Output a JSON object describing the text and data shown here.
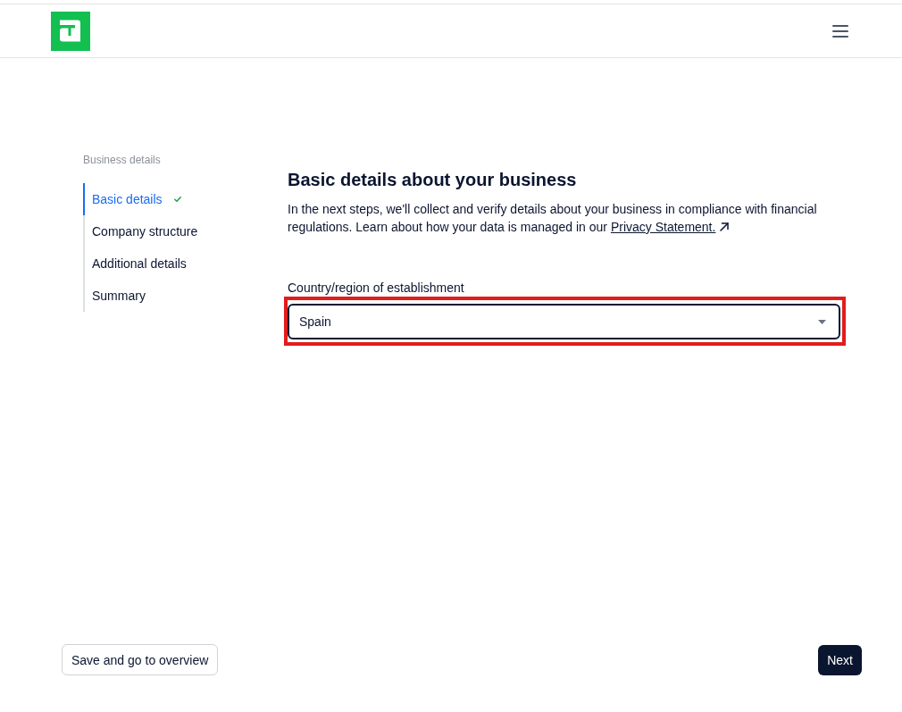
{
  "sidebar": {
    "heading": "Business details",
    "steps": [
      {
        "label": "Basic details",
        "selected": true,
        "completed": true
      },
      {
        "label": "Company structure",
        "selected": false,
        "completed": false
      },
      {
        "label": "Additional details",
        "selected": false,
        "completed": false
      },
      {
        "label": "Summary",
        "selected": false,
        "completed": false
      }
    ]
  },
  "main": {
    "title": "Basic details about your business",
    "intro": "In the next steps, we'll collect and verify details about your business in compliance with financial regulations. Learn about how your data is managed in our",
    "link": "Privacy Statement.",
    "field": {
      "label": "Country/region of establishment",
      "value": "Spain",
      "highlighted": true
    }
  },
  "footer": {
    "buttons": [
      {
        "label": "Save and go to overview",
        "kind": "secondary"
      },
      {
        "label": "Next",
        "kind": "primary"
      }
    ]
  }
}
